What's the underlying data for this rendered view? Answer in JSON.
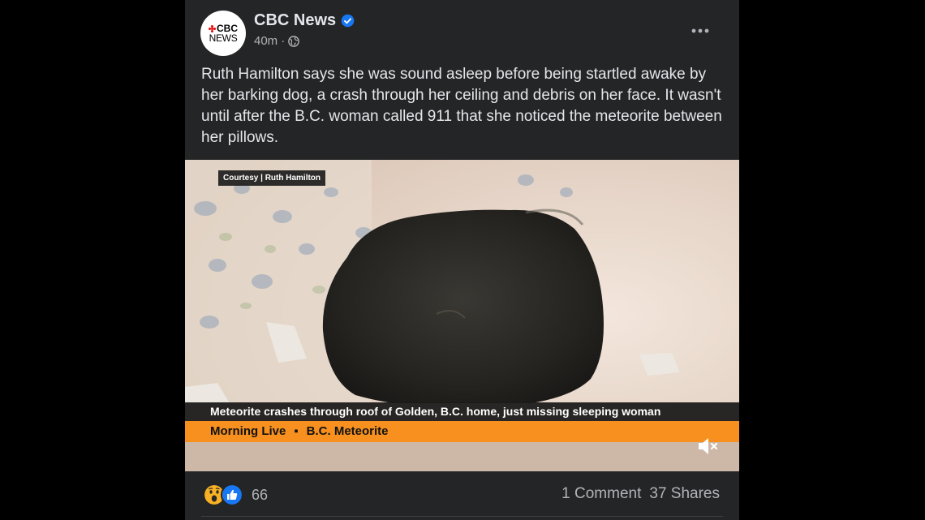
{
  "post": {
    "page_name": "CBC News",
    "avatar": {
      "line1": "CBC",
      "line2": "NEWS"
    },
    "time": "40m",
    "separator": "·",
    "privacy_icon": "globe-icon",
    "verified_icon": "verified-badge-icon",
    "more_icon": "more-options-icon",
    "caption": "Ruth Hamilton says she was sound asleep before being startled awake by her barking dog, a crash through her ceiling and debris on her face. It wasn't until after the B.C. woman called 911 that she noticed the meteorite between her pillows."
  },
  "video": {
    "courtesy": "Courtesy | Ruth Hamilton",
    "headline": "Meteorite crashes through roof of Golden, B.C. home, just missing sleeping woman",
    "show": "Morning Live",
    "bullet": "▪",
    "segment": "B.C. Meteorite",
    "mute_icon": "muted-speaker-icon"
  },
  "engagement": {
    "reaction_icons": [
      "wow-icon",
      "like-icon"
    ],
    "reaction_count": "66",
    "comments": "1 Comment",
    "shares": "37 Shares"
  },
  "colors": {
    "card_bg": "#242526",
    "text_primary": "#e4e6eb",
    "text_secondary": "#b0b3b8",
    "verified_blue": "#1877f2",
    "cbc_red": "#e60505",
    "ticker_orange": "#f7901e"
  }
}
